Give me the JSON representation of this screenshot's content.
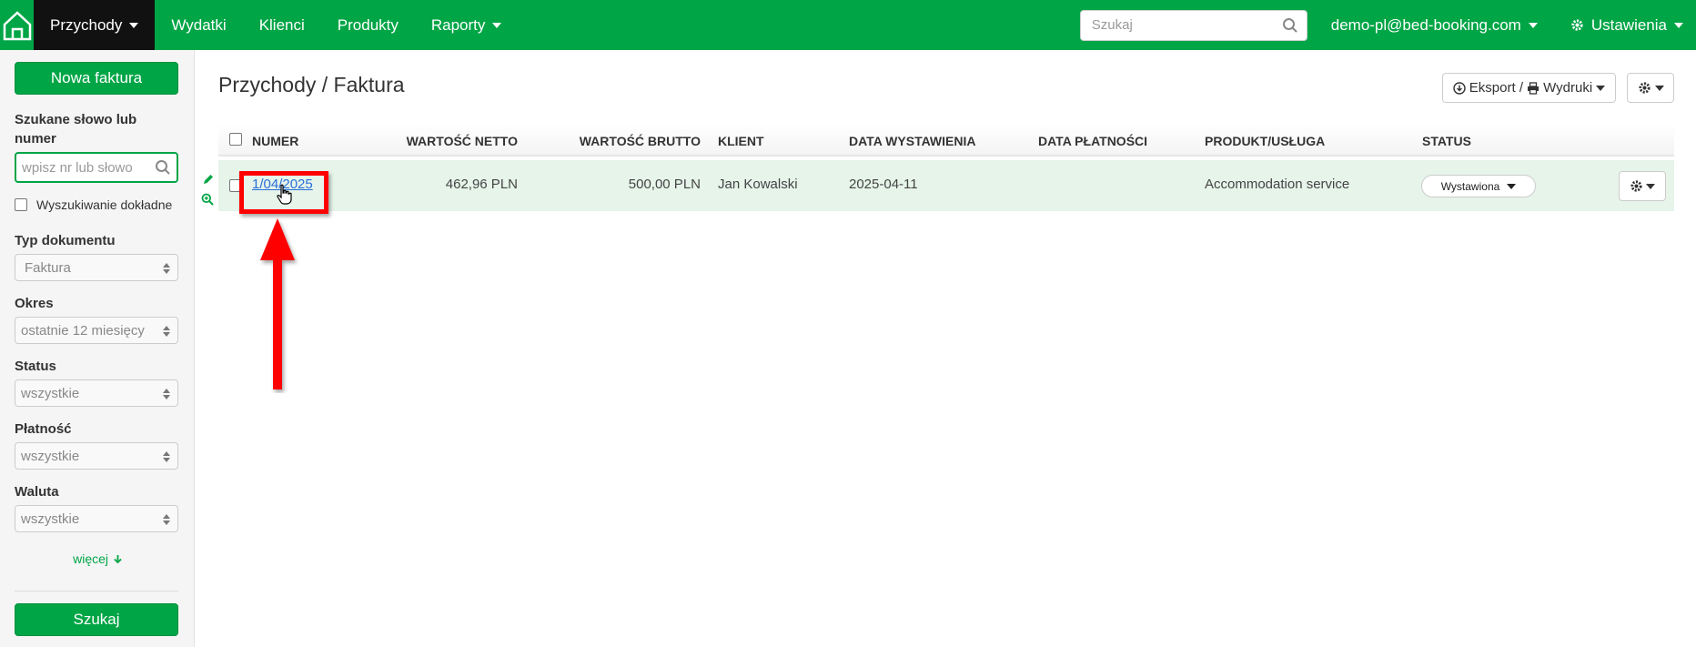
{
  "nav": {
    "items": [
      {
        "label": "Przychody",
        "active": true,
        "dropdown": true
      },
      {
        "label": "Wydatki",
        "active": false,
        "dropdown": false
      },
      {
        "label": "Klienci",
        "active": false,
        "dropdown": false
      },
      {
        "label": "Produkty",
        "active": false,
        "dropdown": false
      },
      {
        "label": "Raporty",
        "active": false,
        "dropdown": true
      }
    ],
    "search_placeholder": "Szukaj",
    "user": "demo-pl@bed-booking.com",
    "settings": "Ustawienia",
    "accent_color": "#00a546"
  },
  "sidebar": {
    "new_invoice_button": "Nowa faktura",
    "search_label": "Szukane słowo lub numer",
    "search_placeholder": "wpisz nr lub słowo",
    "exact_search_label": "Wyszukiwanie dokładne",
    "filters": [
      {
        "label": "Typ dokumentu",
        "value": "Faktura"
      },
      {
        "label": "Okres",
        "value": "ostatnie 12 miesięcy"
      },
      {
        "label": "Status",
        "value": "wszystkie"
      },
      {
        "label": "Płatność",
        "value": "wszystkie"
      },
      {
        "label": "Waluta",
        "value": "wszystkie"
      }
    ],
    "more_link": "więcej",
    "search_button": "Szukaj"
  },
  "main": {
    "title": "Przychody / Faktura",
    "export_button": "Eksport / ",
    "print_button": "Wydruki",
    "table": {
      "headers": [
        "NUMER",
        "WARTOŚĆ NETTO",
        "WARTOŚĆ BRUTTO",
        "KLIENT",
        "DATA WYSTAWIENIA",
        "DATA PŁATNOŚCI",
        "PRODUKT/USŁUGA",
        "STATUS"
      ],
      "rows": [
        {
          "number": "1/04/2025",
          "net": "462,96 PLN",
          "gross": "500,00 PLN",
          "client": "Jan Kowalski",
          "issue_date": "2025-04-11",
          "payment_date": "",
          "product": "Accommodation service",
          "status": "Wystawiona"
        }
      ]
    }
  },
  "annotation": {
    "color": "#ff0000"
  }
}
